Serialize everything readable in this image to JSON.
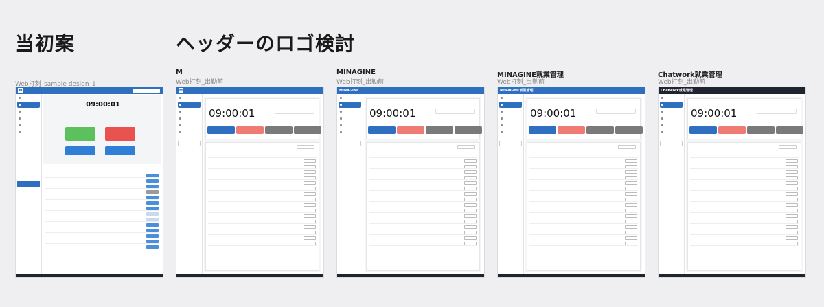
{
  "headings": {
    "left": "当初案",
    "right": "ヘッダーのロゴ検討"
  },
  "columns": [
    {
      "title": "",
      "subtitle": "Web打刻_sample design_1"
    },
    {
      "title": "M",
      "subtitle": "Web打刻_出勤前"
    },
    {
      "title": "MINAGINE",
      "subtitle": "Web打刻_出勤前"
    },
    {
      "title": "MINAGINE就業管理",
      "subtitle": "Web打刻_出勤前"
    },
    {
      "title": "Chatwork就業管理",
      "subtitle": "Web打刻_出勤前"
    }
  ],
  "mockup": {
    "clock": "09:00:01",
    "logos": [
      "",
      "",
      "MINAGINE",
      "MINAGINE就業管理",
      "Chatwork就業管理"
    ]
  },
  "colors": {
    "blue": "#2e6fbf",
    "green": "#5cc05c",
    "red": "#e8534f",
    "pink": "#ef7b74",
    "gray": "#7a7a7a",
    "dark": "#1f2430"
  }
}
